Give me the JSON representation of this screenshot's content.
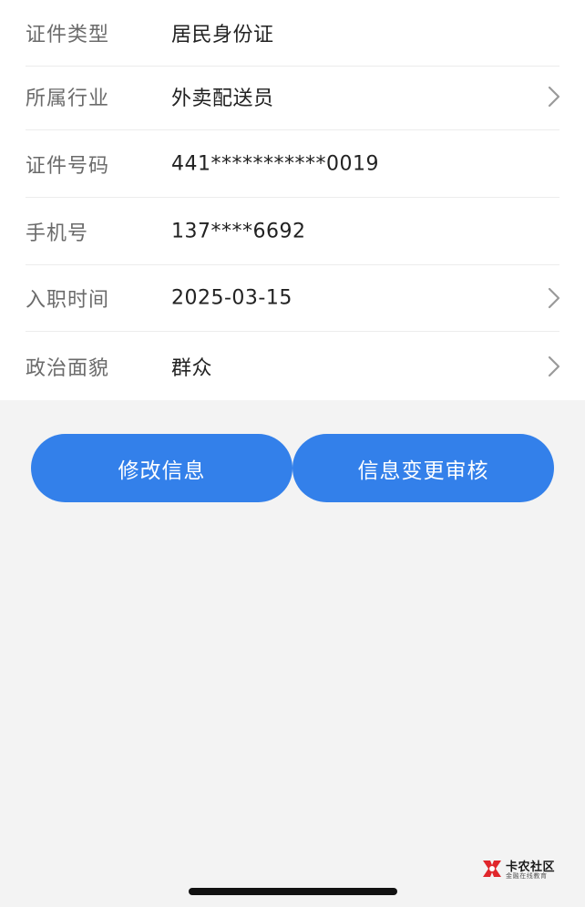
{
  "rows": [
    {
      "label": "证件类型",
      "value": "居民身份证",
      "has_chevron": false
    },
    {
      "label": "所属行业",
      "value": "外卖配送员",
      "has_chevron": true
    },
    {
      "label": "证件号码",
      "value": "441***********0019",
      "has_chevron": false
    },
    {
      "label": "手机号",
      "value": "137****6692",
      "has_chevron": false
    },
    {
      "label": "入职时间",
      "value": "2025-03-15",
      "has_chevron": true
    },
    {
      "label": "政治面貌",
      "value": "群众",
      "has_chevron": true
    }
  ],
  "buttons": {
    "edit_label": "修改信息",
    "review_label": "信息变更审核"
  },
  "watermark": {
    "title": "卡农社区",
    "subtitle": "金融在线教育"
  },
  "colors": {
    "accent": "#3380ea",
    "background": "#f3f3f3",
    "card": "#ffffff",
    "label_text": "#6b6b6b",
    "value_text": "#222222",
    "watermark_red": "#e0262b"
  }
}
